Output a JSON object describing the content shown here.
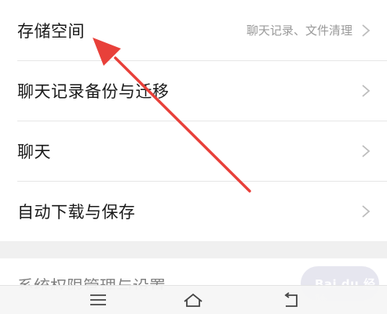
{
  "settings": {
    "items": [
      {
        "label": "存储空间",
        "subtitle": "聊天记录、文件清理"
      },
      {
        "label": "聊天记录备份与迁移"
      },
      {
        "label": "聊天"
      },
      {
        "label": "自动下载与保存"
      }
    ],
    "partial_label": "系统权限管理与设置"
  },
  "watermark": {
    "text": "Bai du 经验"
  },
  "colors": {
    "arrow": "#e8403a",
    "chevron": "#bdbdbd",
    "subtitle": "#9a9a9a"
  },
  "icons": {
    "chevron": "chevron-right-icon",
    "nav_menu": "menu-icon",
    "nav_home": "home-icon",
    "nav_back": "back-icon"
  }
}
